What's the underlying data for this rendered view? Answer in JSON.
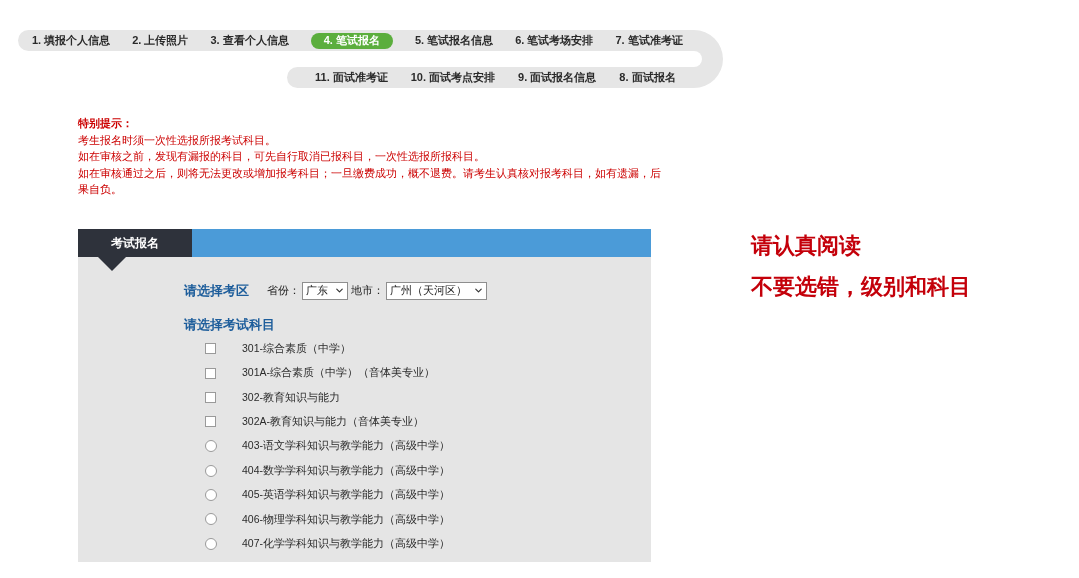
{
  "progress": {
    "rows": [
      {
        "steps": [
          {
            "label": "1. 填报个人信息",
            "selected": false
          },
          {
            "label": "2. 上传照片",
            "selected": false
          },
          {
            "label": "3. 查看个人信息",
            "selected": false
          },
          {
            "label": "4. 笔试报名",
            "selected": true
          },
          {
            "label": "5. 笔试报名信息",
            "selected": false
          },
          {
            "label": "6. 笔试考场安排",
            "selected": false
          },
          {
            "label": "7. 笔试准考证",
            "selected": false
          }
        ]
      },
      {
        "steps": [
          {
            "label": "11. 面试准考证",
            "selected": false
          },
          {
            "label": "10. 面试考点安排",
            "selected": false
          },
          {
            "label": "9. 面试报名信息",
            "selected": false
          },
          {
            "label": "8. 面试报名",
            "selected": false
          }
        ]
      }
    ]
  },
  "notice": {
    "title": "特别提示：",
    "lines": [
      "考生报名时须一次性选报所报考试科目。",
      "如在审核之前，发现有漏报的科目，可先自行取消已报科目，一次性选报所报科目。",
      "如在审核通过之后，则将无法更改或增加报考科目；一旦缴费成功，概不退费。请考生认真核对报考科目，如有遗漏，后果自负。"
    ]
  },
  "panel": {
    "tab": "考试报名",
    "region": {
      "heading": "请选择考区",
      "fields": [
        {
          "label": "省份：",
          "value": "广东"
        },
        {
          "label": "地市：",
          "value": "广州（天河区）"
        }
      ]
    },
    "subjects": {
      "heading": "请选择考试科目",
      "items": [
        {
          "kind": "checkbox",
          "label": "301-综合素质（中学）",
          "checked": false
        },
        {
          "kind": "checkbox",
          "label": "301A-综合素质（中学）（音体美专业）",
          "checked": false
        },
        {
          "kind": "checkbox",
          "label": "302-教育知识与能力",
          "checked": false
        },
        {
          "kind": "checkbox",
          "label": "302A-教育知识与能力（音体美专业）",
          "checked": false
        },
        {
          "kind": "radio",
          "label": "403-语文学科知识与教学能力（高级中学）",
          "selected": false
        },
        {
          "kind": "radio",
          "label": "404-数学学科知识与教学能力（高级中学）",
          "selected": false
        },
        {
          "kind": "radio",
          "label": "405-英语学科知识与教学能力（高级中学）",
          "selected": false
        },
        {
          "kind": "radio",
          "label": "406-物理学科知识与教学能力（高级中学）",
          "selected": false
        },
        {
          "kind": "radio",
          "label": "407-化学学科知识与教学能力（高级中学）",
          "selected": false
        }
      ]
    }
  },
  "annotations": [
    "请认真阅读",
    "不要选错，级别和科目"
  ]
}
